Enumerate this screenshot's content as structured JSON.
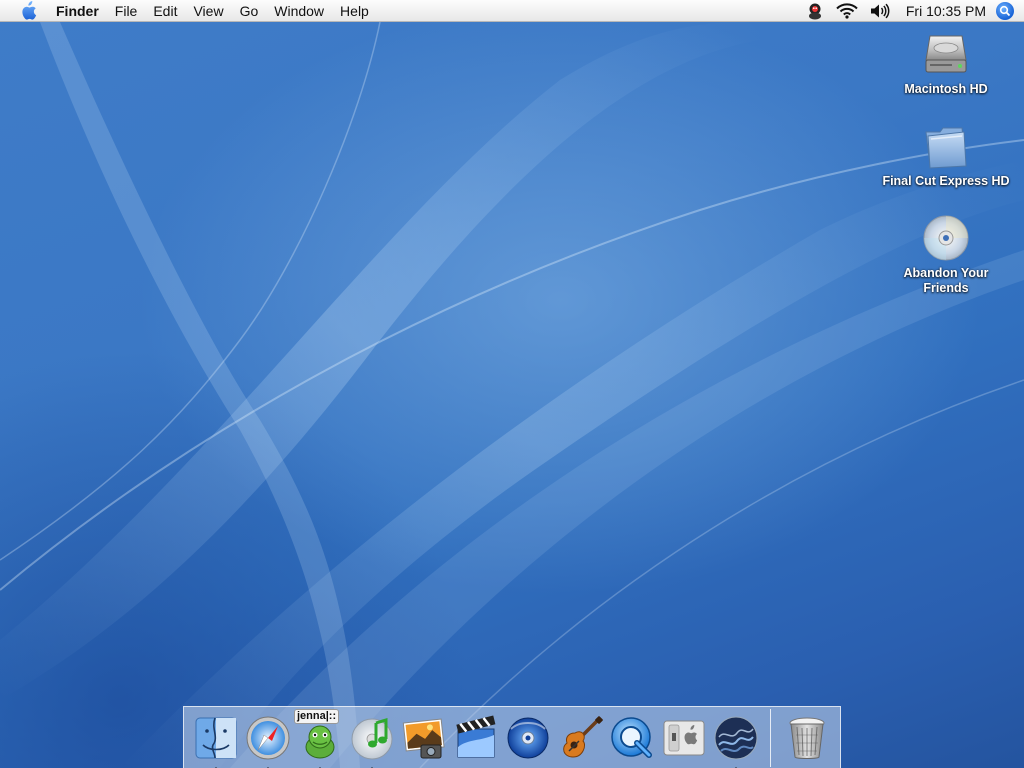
{
  "menubar": {
    "app_name": "Finder",
    "menus": [
      "File",
      "Edit",
      "View",
      "Go",
      "Window",
      "Help"
    ],
    "clock": "Fri 10:35 PM",
    "status_icons": [
      "adium-duck-icon",
      "wifi-icon",
      "volume-icon",
      "spotlight-icon"
    ]
  },
  "desktop": {
    "icons": [
      {
        "label": "Macintosh HD",
        "icon": "hard-drive-icon"
      },
      {
        "label": "Final Cut Express HD",
        "icon": "folder-icon"
      },
      {
        "label": "Abandon Your Friends",
        "icon": "cd-disc-icon"
      }
    ]
  },
  "dock": {
    "apps": [
      {
        "name": "Finder",
        "icon": "finder-icon",
        "running": true
      },
      {
        "name": "Safari",
        "icon": "safari-compass-icon",
        "running": true
      },
      {
        "name": "Adium",
        "icon": "adium-frog-icon",
        "running": true,
        "badge": "jenna|::"
      },
      {
        "name": "iTunes",
        "icon": "itunes-icon",
        "running": true
      },
      {
        "name": "iPhoto",
        "icon": "iphoto-icon",
        "running": false
      },
      {
        "name": "iMovie",
        "icon": "imovie-icon",
        "running": false
      },
      {
        "name": "iDVD",
        "icon": "idvd-icon",
        "running": false
      },
      {
        "name": "GarageBand",
        "icon": "garageband-guitar-icon",
        "running": false
      },
      {
        "name": "QuickTime Player",
        "icon": "quicktime-icon",
        "running": false
      },
      {
        "name": "System Preferences",
        "icon": "system-preferences-icon",
        "running": false
      },
      {
        "name": "Dashboard",
        "icon": "dashboard-wave-icon",
        "running": true
      }
    ],
    "trash": {
      "name": "Trash",
      "icon": "trash-icon"
    }
  }
}
